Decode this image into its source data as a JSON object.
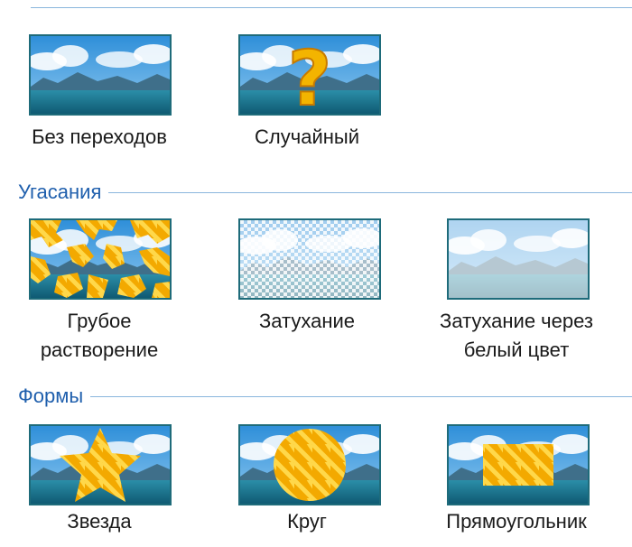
{
  "groups": {
    "basic": {
      "items": [
        {
          "label": "Без переходов",
          "icon": "landscape-thumbnail"
        },
        {
          "label": "Случайный",
          "icon": "question-mark-thumbnail"
        }
      ]
    },
    "fades": {
      "title": "Угасания",
      "items": [
        {
          "label": "Грубое\nрастворение",
          "icon": "coarse-dissolve-thumbnail"
        },
        {
          "label": "Затухание",
          "icon": "fade-thumbnail"
        },
        {
          "label": "Затухание через\nбелый цвет",
          "icon": "fade-white-thumbnail"
        }
      ]
    },
    "shapes": {
      "title": "Формы",
      "items": [
        {
          "label": "Звезда",
          "icon": "star-thumbnail"
        },
        {
          "label": "Круг",
          "icon": "circle-thumbnail"
        },
        {
          "label": "Прямоугольник",
          "icon": "rectangle-thumbnail"
        }
      ]
    }
  },
  "colors": {
    "accent": "#1f5fad",
    "rule": "#8ab6dd",
    "thumb_border": "#1e6b7a",
    "sunburst": "#f5b800"
  }
}
